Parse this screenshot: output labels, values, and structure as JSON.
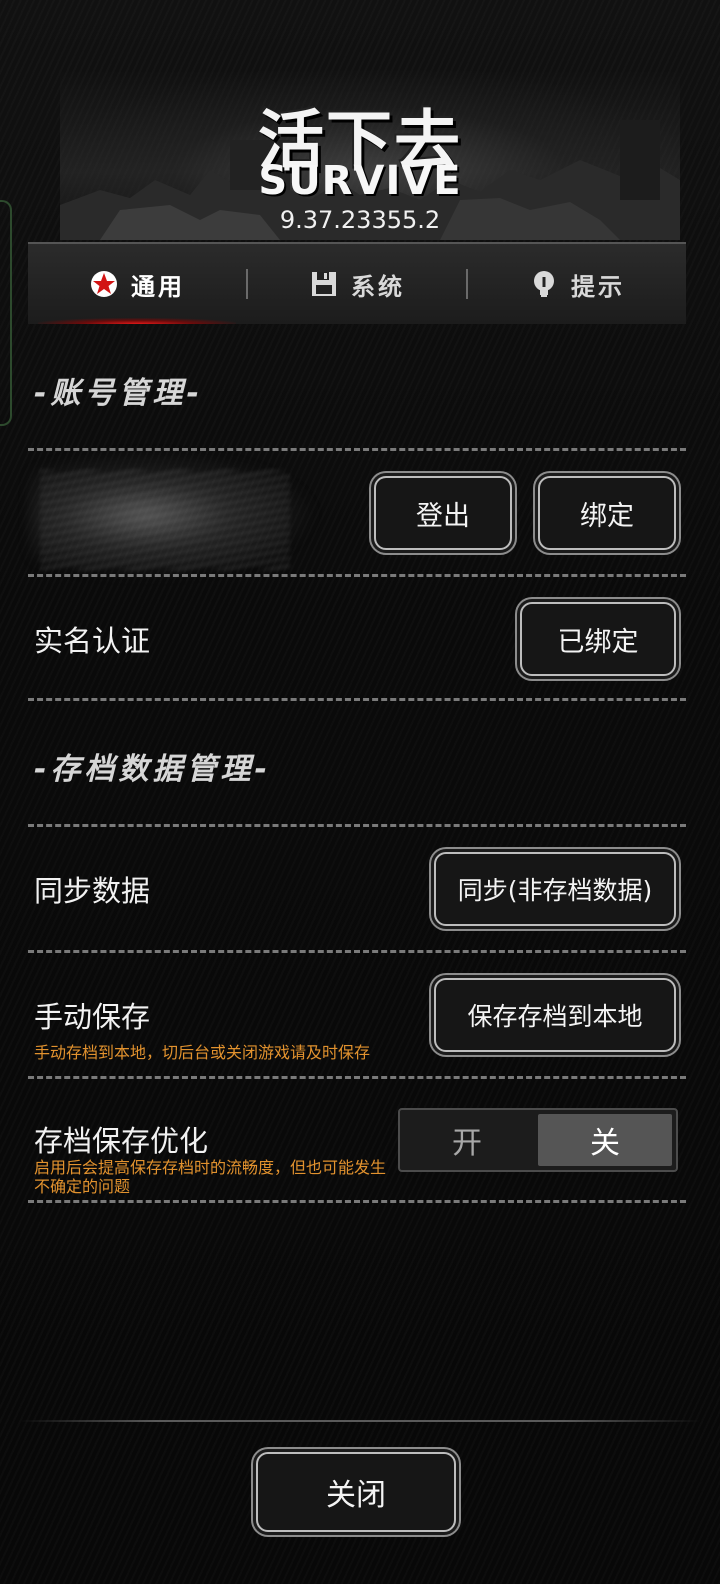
{
  "header": {
    "logo_cn": "活下去",
    "logo_en": "SURVIVE",
    "version": "9.37.23355.2"
  },
  "tabs": [
    {
      "label": "通用",
      "icon": "star-icon",
      "active": true
    },
    {
      "label": "系统",
      "icon": "floppy-disk-icon",
      "active": false
    },
    {
      "label": "提示",
      "icon": "lightbulb-icon",
      "active": false
    }
  ],
  "account_section": {
    "title": "-账号管理-",
    "logout_label": "登出",
    "bind_label": "绑定",
    "realname_label": "实名认证",
    "realname_button": "已绑定"
  },
  "data_section": {
    "title": "-存档数据管理-",
    "sync_label": "同步数据",
    "sync_button": "同步(非存档数据)",
    "manual_save_label": "手动保存",
    "manual_save_hint": "手动存档到本地，切后台或关闭游戏请及时保存",
    "manual_save_button": "保存存档到本地",
    "optimize_label": "存档保存优化",
    "optimize_hint": "启用后会提高保存存档时的流畅度，但也可能发生不确定的问题",
    "toggle_on": "开",
    "toggle_off": "关",
    "toggle_selected": "关"
  },
  "footer": {
    "close_label": "关闭"
  },
  "colors": {
    "accent_red": "#e01818",
    "hint_orange": "#e2922e",
    "background": "#0b0b0b"
  }
}
